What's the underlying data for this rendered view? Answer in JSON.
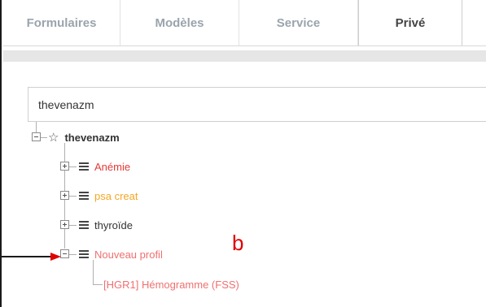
{
  "tabs": [
    {
      "label": "Formulaires"
    },
    {
      "label": "Modèles"
    },
    {
      "label": "Service"
    },
    {
      "label": "Privé",
      "active": true
    }
  ],
  "search": {
    "value": "thevenazm"
  },
  "tree": {
    "root": {
      "label": "thevenazm",
      "expanded": true
    },
    "children": [
      {
        "label": "Anémie",
        "color": "#e53935",
        "expanded": false
      },
      {
        "label": "psa creat",
        "color": "#f5a623",
        "expanded": false
      },
      {
        "label": "thyroïde",
        "color": "#333333",
        "expanded": false
      },
      {
        "label": "Nouveau profil",
        "color": "#f07070",
        "expanded": true,
        "children": [
          {
            "label": "[HGR1] Hémogramme (FSS)",
            "color": "#f07070"
          }
        ]
      }
    ]
  },
  "annotation": {
    "letter": "b",
    "color": "#e00000"
  }
}
